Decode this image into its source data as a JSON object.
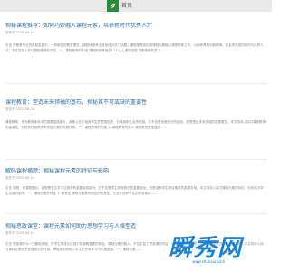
{
  "header": {
    "home_label": "首页"
  },
  "articles": [
    {
      "title": "揭秘课程推荐：如何巧妙融入课程元素，培养新时代优秀人才",
      "date": "发布于 2025-06-24",
      "body": "引言 在教育行业的蓬勃发展中，一种新型的教育理念，课程化培养正逐渐成为热门话题。课程推荐如何将课程元素融入课程推荐之中，以培养具有创新精神、社会责任感的新时代优秀人才，本文将深入探讨课程推荐的内容。一、课程推荐的内涵 课程推荐是指在11个以上课程范围 课程推荐的意义"
    },
    {
      "title": "课程教育：塑造未来领袖的基石，揭秘其不可或缺的重要性",
      "date": "发布于 2025-06-24",
      "body": "课程教育，作为教育体系中的重要组成部分，其核心在于培养学生的思想品质、价值观和社会责任感。它不仅是传授知识的途径，更是塑造未来领袖的重要基石。本文将深入探讨课程教育的重要性，分析其在培养未来领袖方面的关键作用。一、课程教育的内涵 1. 课程教育的定义 课程教育是指通过……"
    },
    {
      "title": "解码课程摘题：揭秘课程元素的特征与影响",
      "date": "发布于 2025-06-24",
      "body": "引言 课程，即课程题目，课程是学生学习过程中的重要组成部分。它不仅是学生获取知识的重要途径，也是培养学生综合素质的重要手段。本文将深入探讨课程元素的特征，分析其对学生发展的影响。一、课程元素的特征 1. 教育性 课程元素具有明显的教育性，它旨在培养学生的综合素质……"
    },
    {
      "title": "揭秘思政课堂：课程元素如何助力思想学习与人格塑造",
      "date": "发布于 2025-06-24",
      "body": "引言 思政课作为一门基础课程，在学生的成长过程中扮演着重要的角色。课程元素的融入，不仅丰富了思政课的内容，也为学生的思想学习与人格塑造提供了有力的支撑。本文将深入探讨课程元素在思政课堂中的作用，揭秘其如何助力学生的思想学习与人格塑造。一、课程元素……"
    }
  ],
  "watermark": {
    "text": "瞬秀网",
    "sub": "www.shunxiu.com"
  },
  "colors": {
    "brand": "#2d8a3a",
    "title_link": "#2f6f9f",
    "watermark": "#1e82d2"
  },
  "icons": {
    "logo": "leaf-icon"
  }
}
